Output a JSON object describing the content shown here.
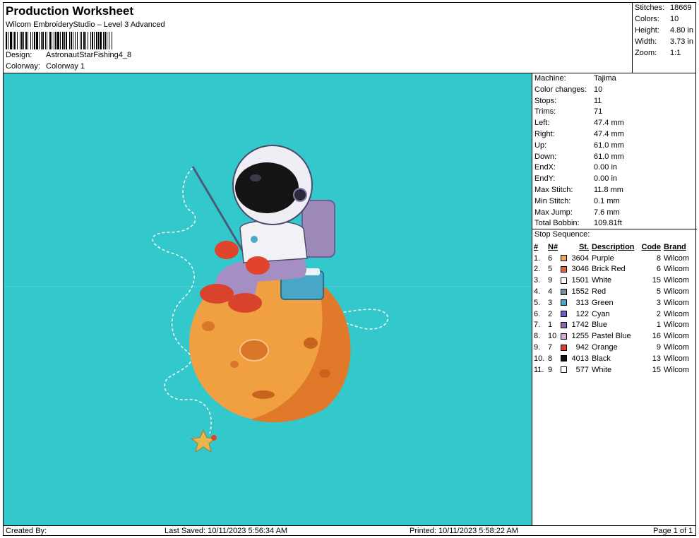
{
  "header": {
    "title": "Production Worksheet",
    "subtitle": "Wilcom EmbroideryStudio – Level 3 Advanced",
    "design_label": "Design:",
    "design_value": "AstronautStarFishing4_8",
    "colorway_label": "Colorway:",
    "colorway_value": "Colorway 1"
  },
  "stats": [
    {
      "label": "Stitches:",
      "value": "18669"
    },
    {
      "label": "Colors:",
      "value": "10"
    },
    {
      "label": "Height:",
      "value": "4.80 in"
    },
    {
      "label": "Width:",
      "value": "3.73 in"
    },
    {
      "label": "Zoom:",
      "value": "1:1"
    }
  ],
  "machine": [
    {
      "label": "Machine:",
      "value": "Tajima"
    },
    {
      "label": "Color changes:",
      "value": "10"
    },
    {
      "label": "Stops:",
      "value": "11"
    },
    {
      "label": "Trims:",
      "value": "71"
    },
    {
      "label": "Left:",
      "value": "47.4 mm"
    },
    {
      "label": "Right:",
      "value": "47.4 mm"
    },
    {
      "label": "Up:",
      "value": "61.0 mm"
    },
    {
      "label": "Down:",
      "value": "61.0 mm"
    },
    {
      "label": "EndX:",
      "value": "0.00 in"
    },
    {
      "label": "EndY:",
      "value": "0.00 in"
    },
    {
      "label": "Max Stitch:",
      "value": "11.8 mm"
    },
    {
      "label": "Min Stitch:",
      "value": "0.1 mm"
    },
    {
      "label": "Max Jump:",
      "value": "7.6 mm"
    },
    {
      "label": "Total Bobbin:",
      "value": "109.81ft"
    }
  ],
  "sequence": {
    "heading": "Stop Sequence:",
    "columns": [
      "#",
      "N#",
      "St.",
      "Description",
      "Code",
      "Brand"
    ],
    "rows": [
      {
        "num": "1.",
        "n": "6",
        "color": "#f2a35c",
        "st": "3604",
        "desc": "Purple",
        "code": "8",
        "brand": "Wilcom"
      },
      {
        "num": "2.",
        "n": "5",
        "color": "#e0663a",
        "st": "3046",
        "desc": "Brick Red",
        "code": "6",
        "brand": "Wilcom"
      },
      {
        "num": "3.",
        "n": "9",
        "color": "#ffffff",
        "st": "1501",
        "desc": "White",
        "code": "15",
        "brand": "Wilcom"
      },
      {
        "num": "4.",
        "n": "4",
        "color": "#6f8fa8",
        "st": "1552",
        "desc": "Red",
        "code": "5",
        "brand": "Wilcom"
      },
      {
        "num": "5.",
        "n": "3",
        "color": "#4aa6c6",
        "st": "313",
        "desc": "Green",
        "code": "3",
        "brand": "Wilcom"
      },
      {
        "num": "6.",
        "n": "2",
        "color": "#6a5acd",
        "st": "122",
        "desc": "Cyan",
        "code": "2",
        "brand": "Wilcom"
      },
      {
        "num": "7.",
        "n": "1",
        "color": "#8b6aa8",
        "st": "1742",
        "desc": "Blue",
        "code": "1",
        "brand": "Wilcom"
      },
      {
        "num": "8.",
        "n": "10",
        "color": "#d9a6d9",
        "st": "1255",
        "desc": "Pastel Blue",
        "code": "16",
        "brand": "Wilcom"
      },
      {
        "num": "9.",
        "n": "7",
        "color": "#e0382a",
        "st": "942",
        "desc": "Orange",
        "code": "9",
        "brand": "Wilcom"
      },
      {
        "num": "10.",
        "n": "8",
        "color": "#111111",
        "st": "4013",
        "desc": "Black",
        "code": "13",
        "brand": "Wilcom"
      },
      {
        "num": "11.",
        "n": "9",
        "color": "#ffffff",
        "st": "577",
        "desc": "White",
        "code": "15",
        "brand": "Wilcom"
      }
    ]
  },
  "footer": {
    "created": "Created By:",
    "saved": "Last Saved: 10/11/2023 5:56:34 AM",
    "printed": "Printed: 10/11/2023 5:58:22 AM",
    "page": "Page 1 of 1"
  },
  "canvas": {
    "background": "#33c9cc",
    "image": "astronaut-fishing-on-moon-embroidery"
  }
}
